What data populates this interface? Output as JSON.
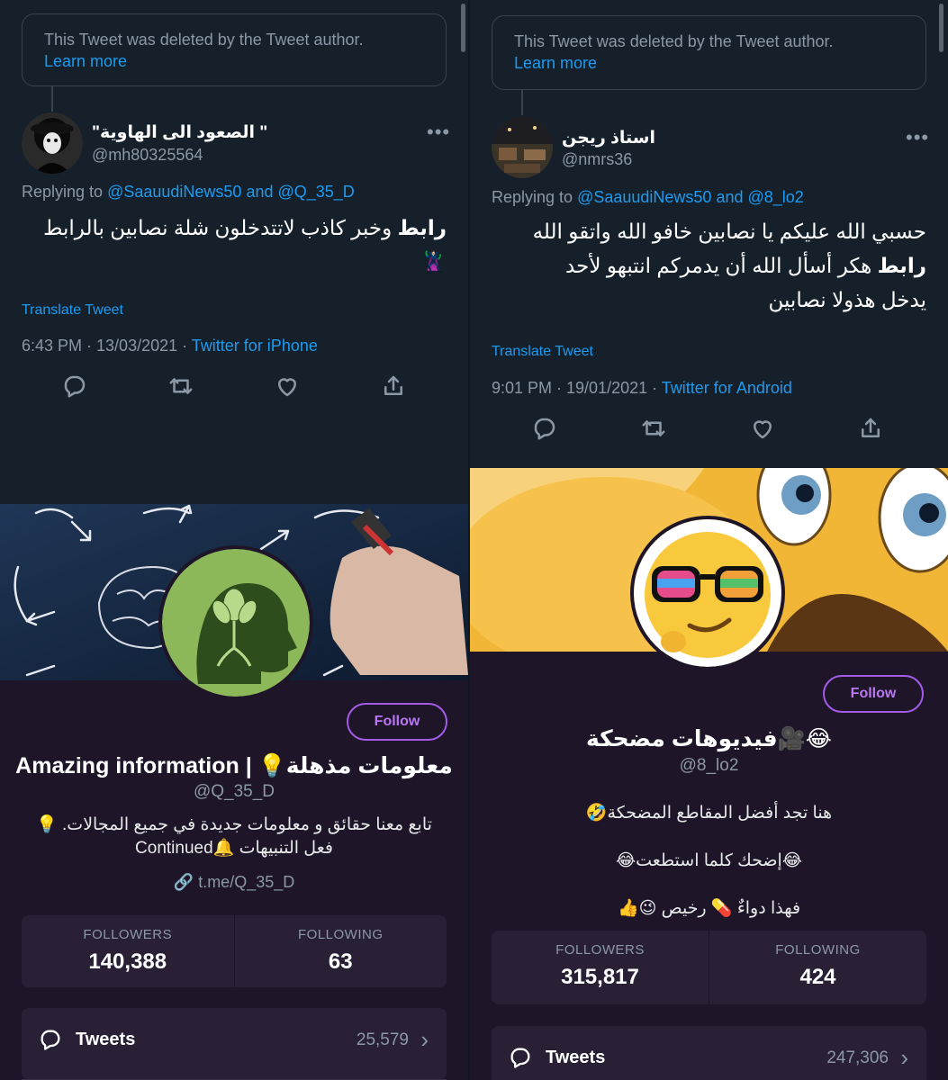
{
  "left": {
    "tweet": {
      "deleted_notice": "This Tweet was deleted by the Tweet author.",
      "learn_more": "Learn more",
      "author_name": "\"الصعود الى الهاوية \"",
      "author_handle": "@mh80325564",
      "more_icon": "more-horizontal",
      "replying_prefix": "Replying to",
      "replying_to": "@SaauudiNews50 and @Q_35_D",
      "body_bold": "رابط",
      "body_rest": " وخبر كاذب لاتتدخلون شلة نصابين بالرابط",
      "body_emoji": "🦹🏻‍♀️",
      "translate": "Translate Tweet",
      "time": "6:43 PM · 13/03/2021 · ",
      "source": "Twitter for iPhone",
      "actions": [
        "reply-icon",
        "retweet-icon",
        "like-icon",
        "share-icon"
      ]
    },
    "profile": {
      "follow_label": "Follow",
      "name": "Amazing information | 💡معلومات مذهلة",
      "handle": "@Q_35_D",
      "bio_line1": "تابع معنا حقائق و معلومات جديدة في جميع المجالات. 💡",
      "bio_line2": "فعل التنبيهات 🔔Continued",
      "link": "t.me/Q_35_D",
      "followers_label": "FOLLOWERS",
      "followers": "140,388",
      "following_label": "FOLLOWING",
      "following": "63",
      "tweets_label": "Tweets",
      "tweets_count": "25,579"
    }
  },
  "right": {
    "tweet": {
      "deleted_notice": "This Tweet was deleted by the Tweet author.",
      "learn_more": "Learn more",
      "author_name": "استاذ ريجن",
      "author_handle": "@nmrs36",
      "more_icon": "more-horizontal",
      "replying_prefix": "Replying to",
      "replying_to": "@SaauudiNews50 and @8_lo2",
      "body_line1": "حسبي الله عليكم يا نصابين خافو الله واتقو الله",
      "body_bold": "رابط",
      "body_line2_rest": " هكر أسأل الله أن يدمركم انتبهو لأحد",
      "body_line3": "يدخل هذولا نصابين",
      "translate": "Translate Tweet",
      "time": "9:01 PM · 19/01/2021 · ",
      "source": "Twitter for Android",
      "actions": [
        "reply-icon",
        "retweet-icon",
        "like-icon",
        "share-icon"
      ]
    },
    "profile": {
      "follow_label": "Follow",
      "name": "فيديوهات مضحكة🎥😂",
      "handle": "@8_lo2",
      "bio_line1": "هنا تجد  أفضل المقاطع المضحكة🤣",
      "bio_line2": "😂إضحك كلما استطعت😂",
      "bio_line3": "فهذا دواءٌ 💊 رخيص 😉👍",
      "followers_label": "FOLLOWERS",
      "followers": "315,817",
      "following_label": "FOLLOWING",
      "following": "424",
      "tweets_label": "Tweets",
      "tweets_count": "247,306"
    }
  },
  "colors": {
    "background": "#15202b",
    "profile_bg": "#1e1628",
    "link_blue": "#1d9bf0",
    "follow_purple": "#a35be8",
    "muted": "#8b98a5"
  }
}
